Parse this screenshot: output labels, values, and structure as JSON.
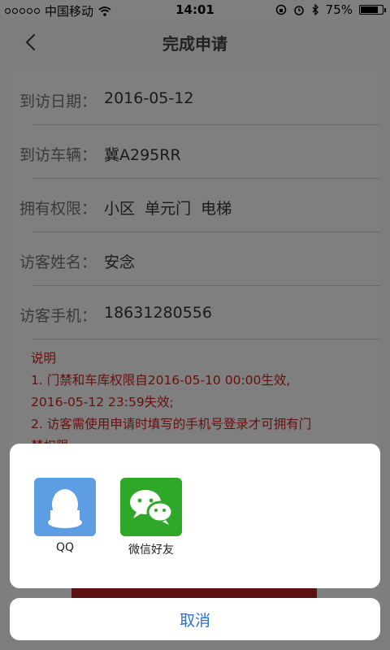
{
  "status_bar": {
    "carrier": "中国移动",
    "time": "14:01",
    "battery": "75%"
  },
  "nav": {
    "title": "完成申请"
  },
  "details": [
    {
      "label": "到访日期：",
      "value": "2016-05-12"
    },
    {
      "label": "到访车辆：",
      "value": "冀A295RR"
    },
    {
      "label": "拥有权限：",
      "value": "小区  单元门  电梯"
    },
    {
      "label": "访客姓名：",
      "value": "安念"
    },
    {
      "label": "访客手机：",
      "value": "18631280556"
    }
  ],
  "notes": {
    "heading": "说明",
    "line1": "1. 门禁和车库权限自2016-05-10 00:00生效,",
    "line2": "2016-05-12 23:59失效;",
    "line3": "2. 访客需使用申请时填写的手机号登录才可拥有门",
    "line4": "禁权限。"
  },
  "share_sheet": {
    "targets": [
      {
        "label": "QQ",
        "icon": "qq-icon",
        "color": "#5d9de3"
      },
      {
        "label": "微信好友",
        "icon": "wechat-icon",
        "color": "#2fa82a"
      }
    ],
    "cancel_label": "取消"
  }
}
